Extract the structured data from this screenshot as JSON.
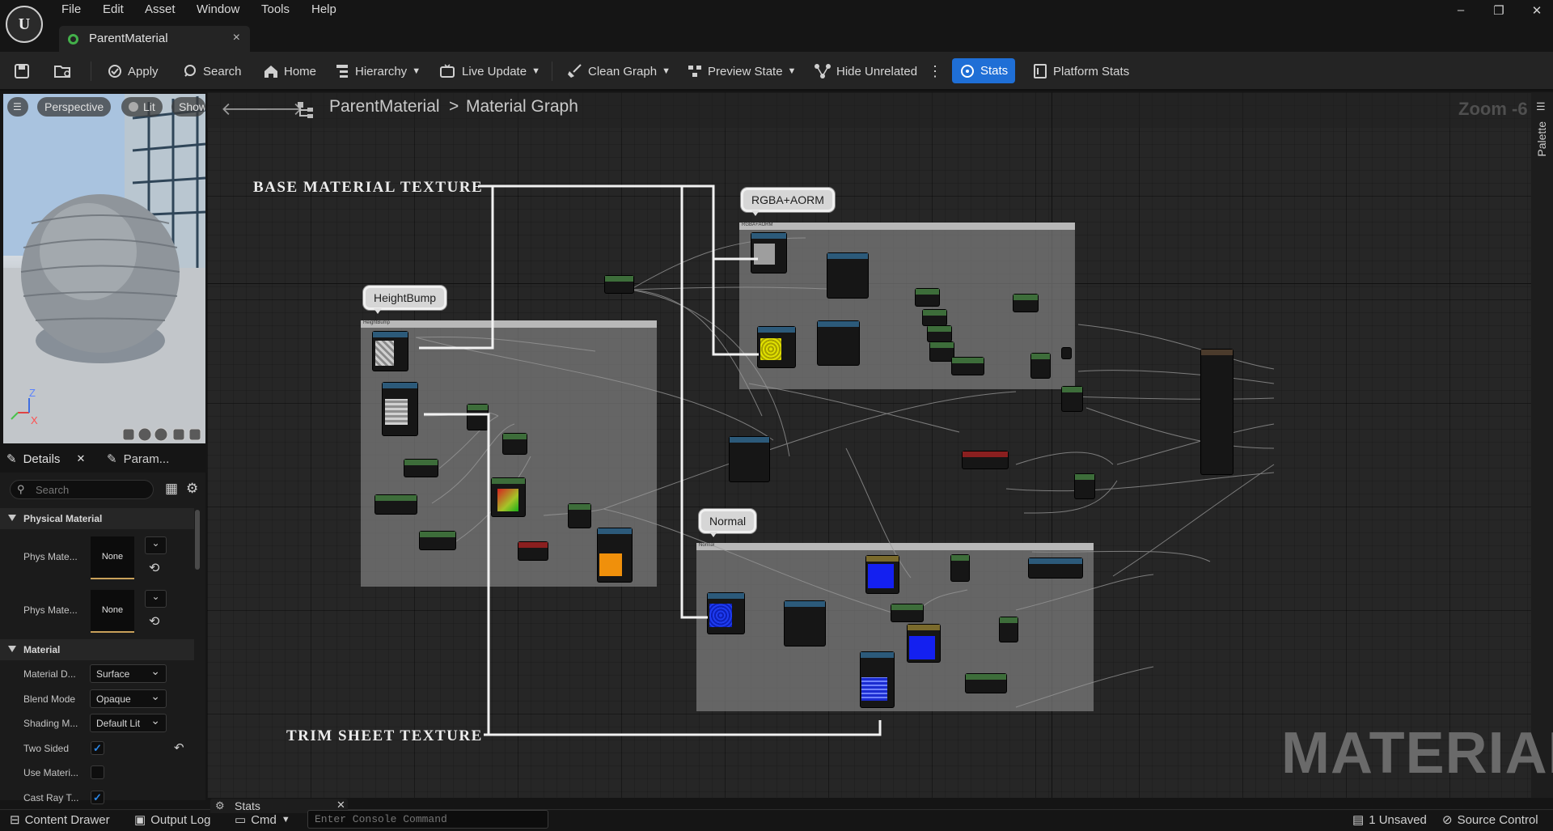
{
  "app": {
    "logo": "unreal-engine-logo"
  },
  "menu": [
    "File",
    "Edit",
    "Asset",
    "Window",
    "Tools",
    "Help"
  ],
  "window_controls": {
    "minimize": "–",
    "restore": "❐",
    "close": "✕"
  },
  "document_tab": {
    "label": "ParentMaterial",
    "close": "×"
  },
  "toolbar": {
    "apply": "Apply",
    "search": "Search",
    "home": "Home",
    "hierarchy": "Hierarchy",
    "live_update": "Live Update",
    "clean_graph": "Clean Graph",
    "preview_state": "Preview State",
    "hide_unrelated": "Hide Unrelated",
    "stats": "Stats",
    "platform_stats": "Platform Stats"
  },
  "viewport": {
    "perspective": "Perspective",
    "lit": "Lit",
    "show": "Show",
    "axis_z": "Z",
    "axis_x": "X"
  },
  "details": {
    "tab_details": "Details",
    "tab_params": "Param...",
    "search_placeholder": "Search",
    "section_physical": "Physical Material",
    "phys_mat_1_label": "Phys Mate...",
    "phys_mat_1_value": "None",
    "phys_mat_2_label": "Phys Mate...",
    "phys_mat_2_value": "None",
    "section_material": "Material",
    "material_domain_label": "Material D...",
    "material_domain_value": "Surface",
    "blend_mode_label": "Blend Mode",
    "blend_mode_value": "Opaque",
    "shading_model_label": "Shading M...",
    "shading_model_value": "Default Lit",
    "two_sided_label": "Two Sided",
    "two_sided_checked": true,
    "use_material_label": "Use Materi...",
    "use_material_checked": false,
    "cast_ray_label": "Cast Ray T...",
    "cast_ray_checked": true
  },
  "graph": {
    "breadcrumb_root": "ParentMaterial",
    "breadcrumb_sep": ">",
    "breadcrumb_leaf": "Material Graph",
    "zoom": "Zoom -6",
    "palette": "Palette",
    "comments": {
      "heightbump": "HeightBump",
      "rgba": "RGBA+AORM",
      "normal": "Normal"
    },
    "annotations": {
      "base": "BASE MATERIAL TEXTURE",
      "trim": "TRIM SHEET TEXTURE"
    },
    "watermark": "MATERIAL"
  },
  "bottom": {
    "content_drawer": "Content Drawer",
    "output_log": "Output Log",
    "cmd": "Cmd",
    "console_placeholder": "Enter Console Command",
    "stats_tab": "Stats",
    "unsaved": "1 Unsaved",
    "source_control": "Source Control"
  },
  "colors": {
    "accent": "#1f6fd6",
    "node_param": "#3d6d3a",
    "node_texture": "#2c5a7a",
    "node_red": "#8a1f1f"
  }
}
